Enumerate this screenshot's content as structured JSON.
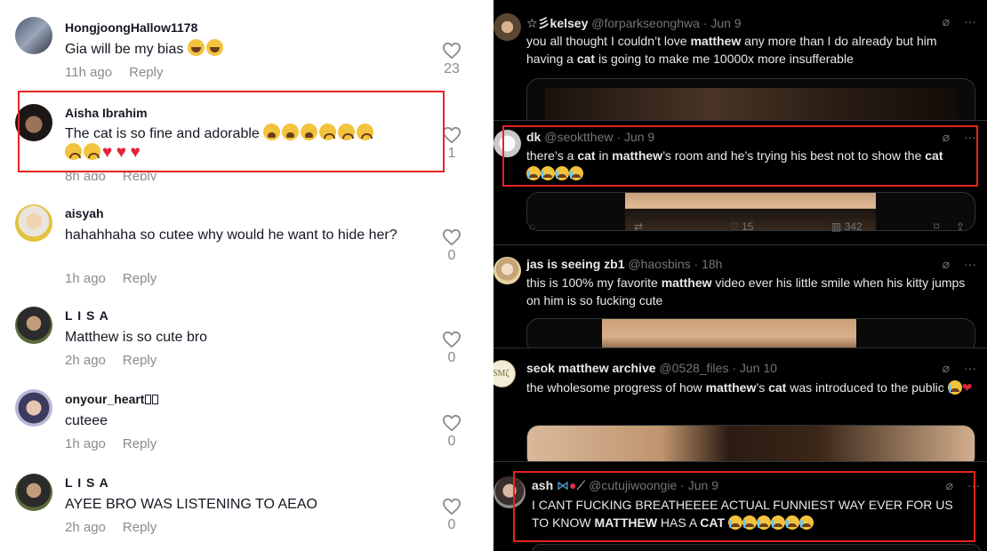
{
  "comments": [
    {
      "username": "HongjoongHallow1178",
      "text": "Gia will be my bias",
      "time": "11h ago",
      "reply": "Reply",
      "likes": "23"
    },
    {
      "username": "Aisha Ibrahim",
      "text": "The cat is so fine and adorable",
      "time": "8h ago",
      "reply": "Reply",
      "likes": "1"
    },
    {
      "username": "aisyah",
      "text": "hahahhaha so cutee why would he want to hide her?",
      "time": "1h ago",
      "reply": "Reply",
      "likes": "0"
    },
    {
      "username": "L I S A",
      "text": "Matthew is so cute bro",
      "time": "2h ago",
      "reply": "Reply",
      "likes": "0"
    },
    {
      "username": "onyour_heart",
      "text": "cuteee",
      "time": "1h ago",
      "reply": "Reply",
      "likes": "0"
    },
    {
      "username": "L I S A",
      "text": "AYEE BRO WAS LISTENING TO AEAO",
      "time": "2h ago",
      "reply": "Reply",
      "likes": "0"
    }
  ],
  "tweets": [
    {
      "name": "☆彡kelsey",
      "handle": "@forparkseonghwa",
      "date": "Jun 9",
      "text_a": "you all thought I couldn’t love ",
      "bold_a": "matthew",
      "text_b": " any more than I do already but him having a ",
      "bold_b": "cat",
      "text_c": " is going to make me 10000x more insufferable"
    },
    {
      "name": "dk",
      "handle": "@seokt‌thew",
      "date": "Jun 9",
      "text_a": "there’s a ",
      "bold_a": "cat",
      "text_b": " in ",
      "bold_b": "matthew",
      "text_c": "’s room and he’s trying his best not to show the ",
      "bold_c": "cat",
      "reply_count": "",
      "retweet_count": "",
      "like_count": "15",
      "view_count": "342"
    },
    {
      "name": "jas is seeing zb1",
      "handle": "@haosbins",
      "date": "18h",
      "text_a": "this is 100% my favorite ",
      "bold_a": "matthew",
      "text_b": " video ever his little smile when his kitty jumps on him is so fucking cute"
    },
    {
      "name": "seok matthew archive",
      "handle": "@0528_files",
      "date": "Jun 10",
      "text_a": "the wholesome progress of how ",
      "bold_a": "matthew",
      "text_b": "’s ",
      "bold_b": "cat",
      "text_c": " was introduced to the public"
    },
    {
      "name": "ash",
      "handle": "@cutujiwoongie",
      "date": "Jun 9",
      "text_a": "I CANT FUCKING BREATHEEEE ACTUAL FUNNIEST WAY EVER FOR US TO KNOW ",
      "bold_a": "MATTHEW",
      "text_b": " HAS A ",
      "bold_b": "CAT"
    }
  ],
  "separator": "·",
  "icons": {
    "mute": "grok-icon",
    "more": "more-icon",
    "like": "heart-icon"
  },
  "colors": {
    "highlight_box": "#e3261d",
    "tiktok_text": "#161823",
    "x_text": "#e7e9ea",
    "x_muted": "#71767b"
  }
}
